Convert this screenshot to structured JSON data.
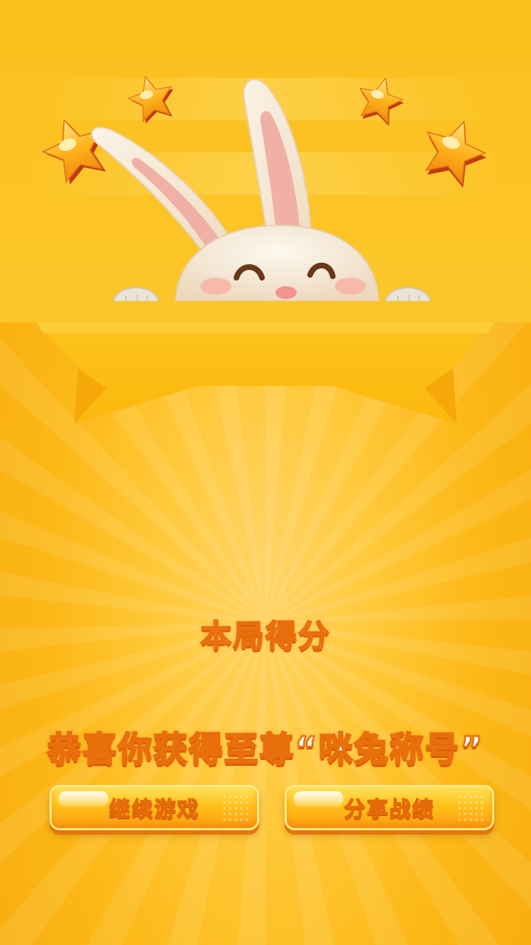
{
  "score": {
    "label": "本局得分"
  },
  "result": {
    "congrats": "恭喜你获得至尊“咪兔称号”"
  },
  "buttons": {
    "continue_label": "继续游戏",
    "share_label": "分享战绩"
  },
  "colors": {
    "background": "#fcb816",
    "banner": "#fbbc10",
    "text_outline": "#e86f0c",
    "star_fill": "#ffb01a",
    "star_edge": "#c13a12"
  },
  "icons": {
    "mascot": "bunny-mascot-icon",
    "stars": [
      "star-icon",
      "star-icon",
      "star-icon",
      "star-icon"
    ]
  }
}
